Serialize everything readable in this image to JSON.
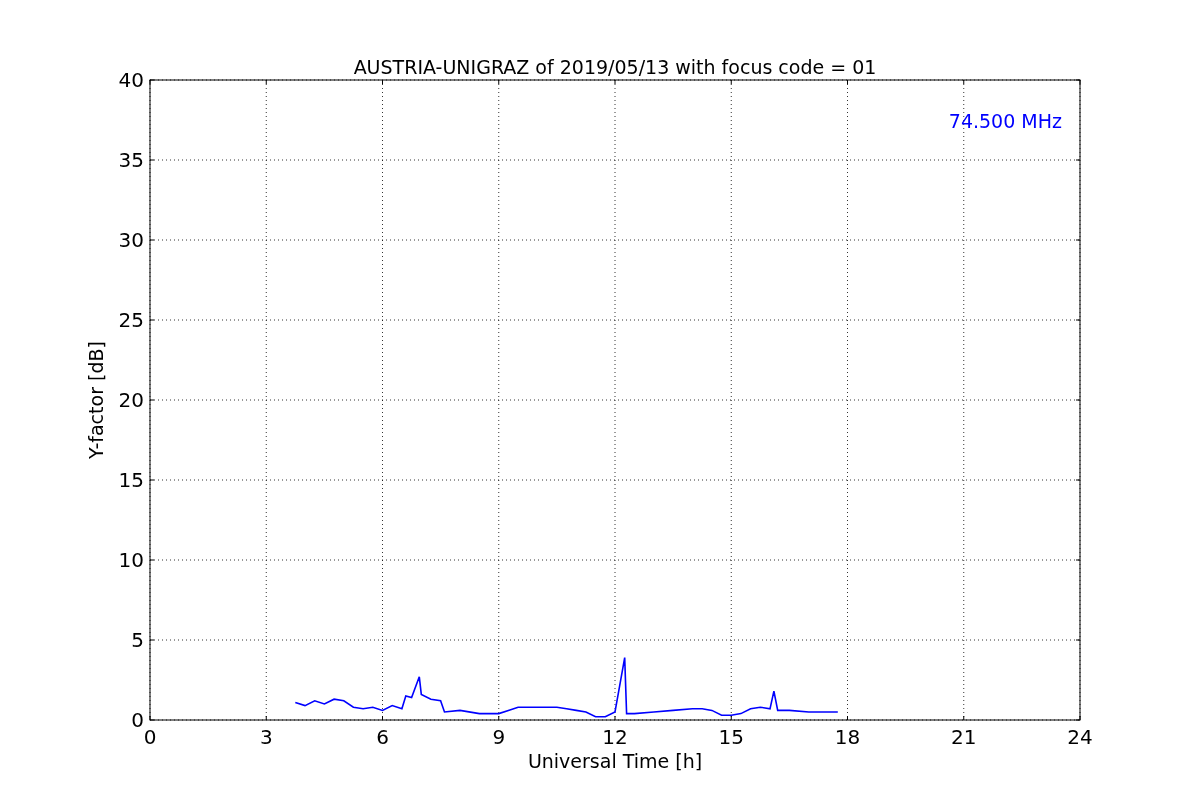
{
  "chart_data": {
    "type": "line",
    "title": "AUSTRIA-UNIGRAZ of 2019/05/13 with focus code = 01",
    "xlabel": "Universal Time [h]",
    "ylabel": "Y-factor [dB]",
    "x": [
      3.75,
      4,
      4.25,
      4.5,
      4.75,
      5,
      5.25,
      5.5,
      5.75,
      6,
      6.25,
      6.5,
      6.6,
      6.75,
      6.95,
      7,
      7.25,
      7.5,
      7.6,
      8,
      8.5,
      9,
      9.25,
      9.5,
      9.75,
      10,
      10.5,
      10.75,
      11,
      11.25,
      11.5,
      11.75,
      12,
      12.25,
      12.3,
      12.5,
      13,
      13.5,
      14,
      14.25,
      14.5,
      14.75,
      15,
      15.25,
      15.5,
      15.75,
      16,
      16.1,
      16.2,
      16.5,
      17,
      17.5,
      17.75
    ],
    "series": [
      {
        "name": "74.500 MHz",
        "color": "#0000ff",
        "values": [
          1.1,
          0.9,
          1.2,
          1.0,
          1.3,
          1.2,
          0.8,
          0.7,
          0.8,
          0.6,
          0.9,
          0.7,
          1.5,
          1.4,
          2.7,
          1.6,
          1.3,
          1.2,
          0.5,
          0.6,
          0.4,
          0.4,
          0.6,
          0.8,
          0.8,
          0.8,
          0.8,
          0.7,
          0.6,
          0.5,
          0.2,
          0.2,
          0.5,
          3.9,
          0.4,
          0.4,
          0.5,
          0.6,
          0.7,
          0.7,
          0.6,
          0.3,
          0.3,
          0.4,
          0.7,
          0.8,
          0.7,
          1.8,
          0.6,
          0.6,
          0.5,
          0.5,
          0.5
        ]
      }
    ],
    "xlim": [
      0,
      24
    ],
    "ylim": [
      0,
      40
    ],
    "xticks": [
      0,
      3,
      6,
      9,
      12,
      15,
      18,
      21,
      24
    ],
    "yticks": [
      0,
      5,
      10,
      15,
      20,
      25,
      30,
      35,
      40
    ],
    "grid": true
  }
}
